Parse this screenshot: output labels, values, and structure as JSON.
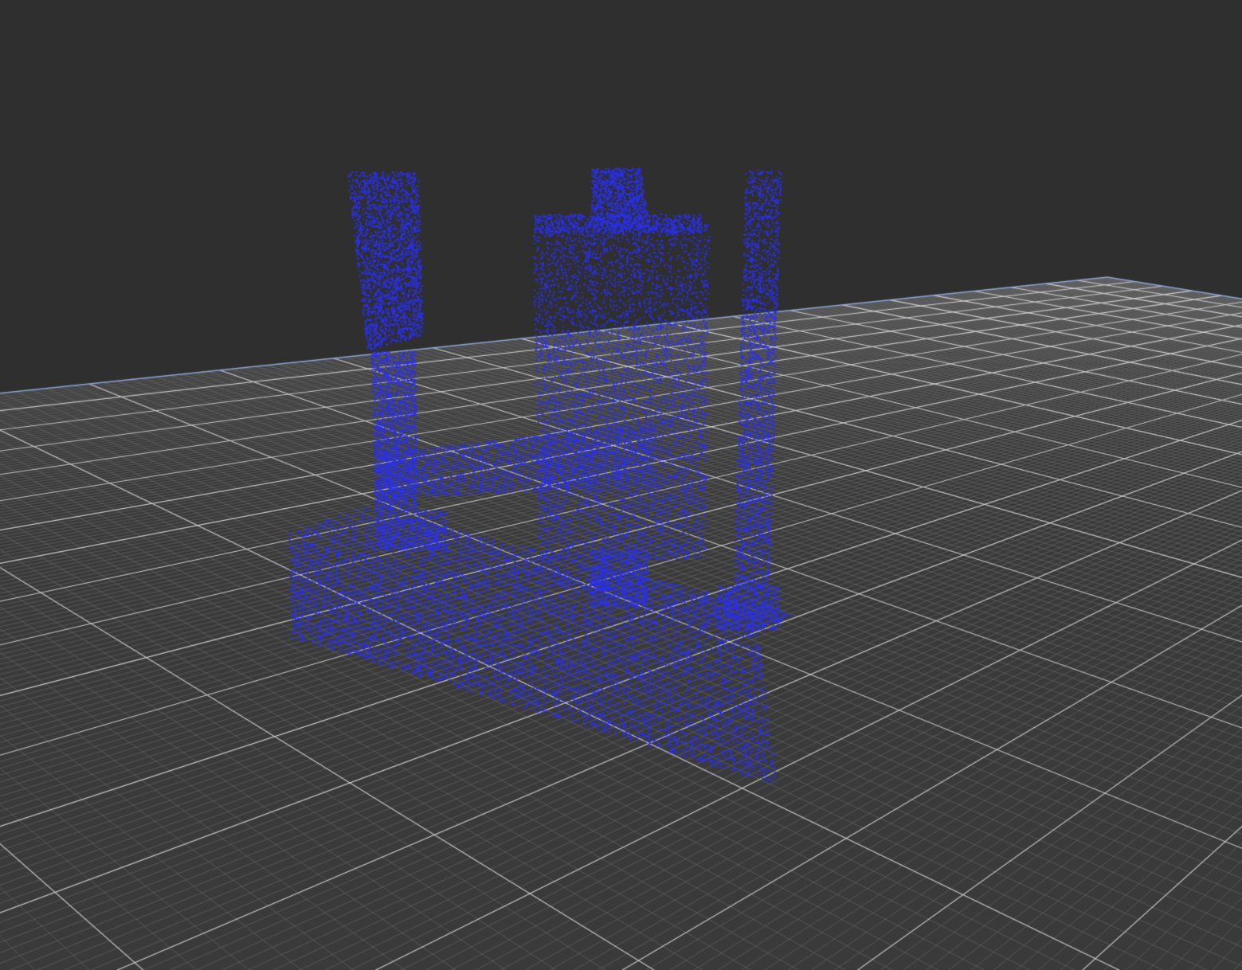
{
  "viewer": {
    "background_color": "#2f2f2f",
    "ground_fill_color": "#3a3a3a",
    "grid_minor_color": "#6c6c6c",
    "grid_major_color": "#d0d0d0",
    "grid_border_color": "#8fa6d8",
    "point_color": "#2a30f0"
  }
}
